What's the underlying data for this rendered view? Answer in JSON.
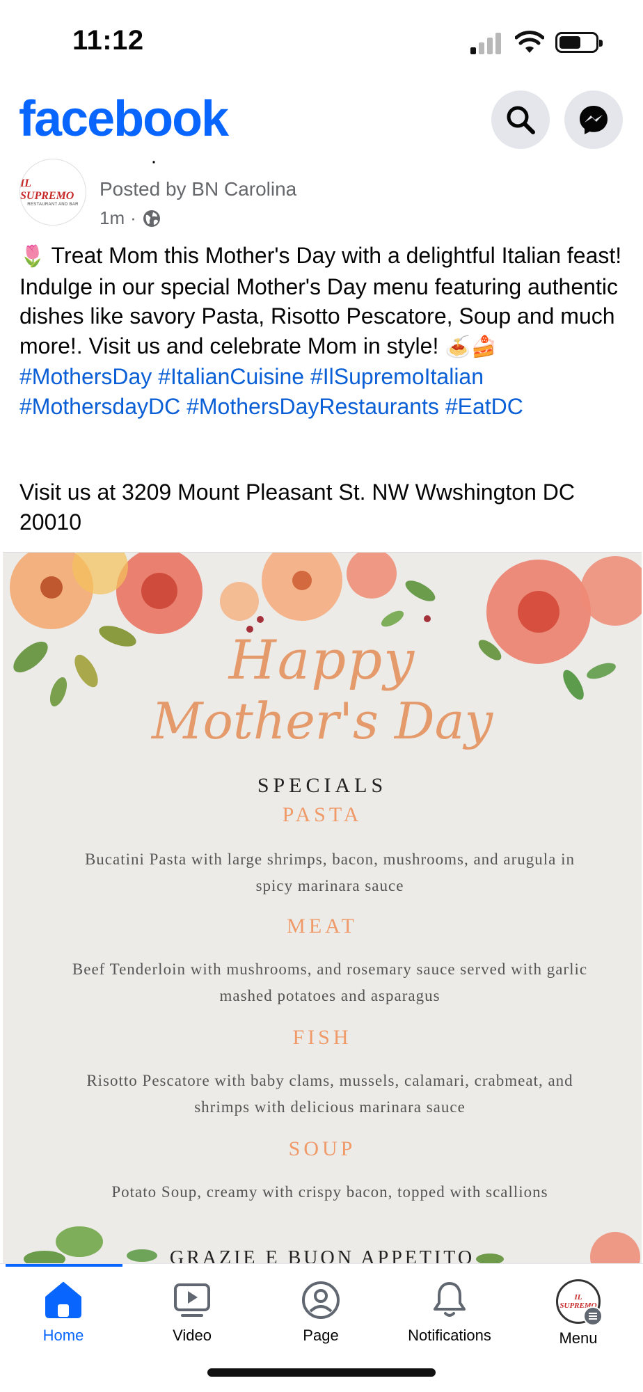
{
  "status_bar": {
    "time": "11:12"
  },
  "header": {
    "logo": "facebook",
    "brand_color": "#0866ff",
    "search_icon": "search-icon",
    "messenger_icon": "messenger-icon"
  },
  "post": {
    "page_avatar_text": "IL SUPREMO",
    "page_avatar_subtext": "RESTAURANT AND BAR",
    "posted_by": "Posted by BN Carolina",
    "time": "1m",
    "privacy_icon": "globe-icon",
    "emoji_tulip": "🌷",
    "text_main": "Treat Mom this Mother's Day with a delightful Italian feast! Indulge in our special Mother's Day menu featuring authentic dishes like savory Pasta, Risotto Pescatore, Soup and much more!. Visit us and celebrate Mom in style!",
    "emoji_food": "🍝🍰",
    "hashtags": [
      "#MothersDay",
      "#ItalianCuisine",
      "#IlSupremoItalian",
      "#MothersdayDC",
      "#MothersDayRestaurants",
      "#EatDC"
    ],
    "address": "Visit us at 3209 Mount Pleasant St. NW Wwshington DC 20010"
  },
  "menu_image": {
    "title_line1": "Happy",
    "title_line2": "Mother's Day",
    "specials": "SPECIALS",
    "sections": [
      {
        "title": "PASTA",
        "description": "Bucatini Pasta with large shrimps, bacon, mushrooms, and arugula in spicy marinara sauce"
      },
      {
        "title": "MEAT",
        "description": "Beef Tenderloin with mushrooms, and rosemary sauce served with garlic mashed potatoes and asparagus"
      },
      {
        "title": "FISH",
        "description": "Risotto Pescatore with baby clams, mussels, calamari, crabmeat, and shrimps with delicious marinara sauce"
      },
      {
        "title": "SOUP",
        "description": "Potato Soup, creamy with crispy bacon, topped with scallions"
      }
    ],
    "closing": "GRAZIE E BUON APPETITO"
  },
  "bottom_nav": {
    "items": [
      {
        "label": "Home",
        "icon": "home-icon",
        "active": true
      },
      {
        "label": "Video",
        "icon": "video-icon",
        "active": false
      },
      {
        "label": "Page",
        "icon": "page-icon",
        "active": false
      },
      {
        "label": "Notifications",
        "icon": "bell-icon",
        "active": false
      },
      {
        "label": "Menu",
        "icon": "menu-avatar",
        "active": false
      }
    ],
    "menu_avatar_text": "IL SUPREMO"
  }
}
